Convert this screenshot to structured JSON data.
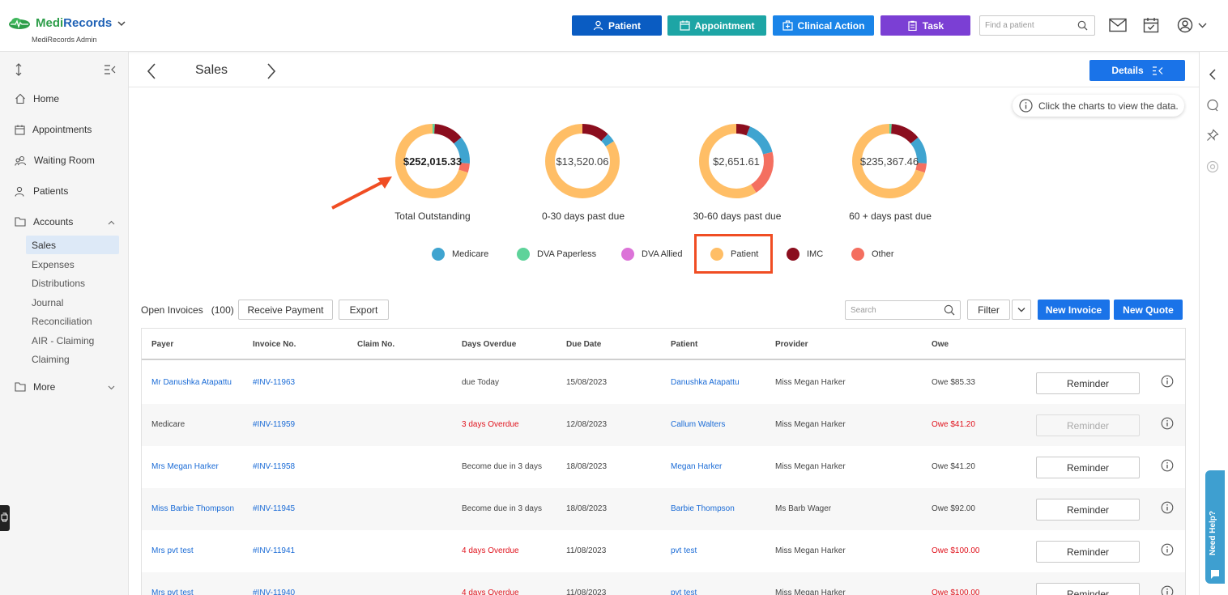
{
  "app": {
    "brand_part1": "Medi",
    "brand_part2": "Records",
    "subtitle": "MediRecords Admin"
  },
  "topbar": {
    "buttons": [
      {
        "label": "Patient",
        "color": "#0a5cc2"
      },
      {
        "label": "Appointment",
        "color": "#1da5a5"
      },
      {
        "label": "Clinical Action",
        "color": "#1a84e8"
      },
      {
        "label": "Task",
        "color": "#7b3fd4"
      }
    ],
    "search_placeholder": "Find a patient"
  },
  "sidebar": {
    "items": [
      {
        "label": "Home",
        "icon": "home-icon"
      },
      {
        "label": "Appointments",
        "icon": "calendar-icon"
      },
      {
        "label": "Waiting Room",
        "icon": "users-icon"
      },
      {
        "label": "Patients",
        "icon": "user-icon"
      },
      {
        "label": "Accounts",
        "icon": "folder-icon"
      }
    ],
    "accounts_sub": [
      "Sales",
      "Expenses",
      "Distributions",
      "Journal",
      "Reconciliation",
      "AIR - Claiming",
      "Claiming"
    ],
    "more_label": "More"
  },
  "page": {
    "title": "Sales",
    "details_label": "Details",
    "hint": "Click the charts to view the data."
  },
  "chart_data": {
    "type": "pie",
    "charts": [
      {
        "label": "Total Outstanding",
        "center": "$252,015.33",
        "slices": {
          "Medicare": 12,
          "DVA Paperless": 1,
          "DVA Allied": 0,
          "Patient": 70,
          "IMC": 13,
          "Other": 4
        }
      },
      {
        "label": "0-30 days past due",
        "center": "$13,520.06",
        "slices": {
          "Medicare": 4,
          "DVA Paperless": 0,
          "DVA Allied": 0,
          "Patient": 84,
          "IMC": 12,
          "Other": 0
        }
      },
      {
        "label": "30-60 days past due",
        "center": "$2,651.61",
        "slices": {
          "Medicare": 15,
          "DVA Paperless": 0,
          "DVA Allied": 0,
          "Patient": 59,
          "IMC": 6,
          "Other": 20
        }
      },
      {
        "label": "60 + days past due",
        "center": "$235,367.46",
        "slices": {
          "Medicare": 12,
          "DVA Paperless": 1,
          "DVA Allied": 0,
          "Patient": 70,
          "IMC": 13,
          "Other": 4
        }
      }
    ],
    "legend": [
      {
        "name": "Medicare",
        "color": "#3fa4d0"
      },
      {
        "name": "DVA Paperless",
        "color": "#5ed39a"
      },
      {
        "name": "DVA Allied",
        "color": "#dc73d8"
      },
      {
        "name": "Patient",
        "color": "#ffbe66"
      },
      {
        "name": "IMC",
        "color": "#8b0e1e"
      },
      {
        "name": "Other",
        "color": "#f46f60"
      }
    ]
  },
  "invoices": {
    "label": "Open Invoices",
    "count": "(100)",
    "receive_payment": "Receive Payment",
    "export": "Export",
    "search_placeholder": "Search",
    "filter": "Filter",
    "new_invoice": "New Invoice",
    "new_quote": "New Quote",
    "columns": [
      "Payer",
      "Invoice No.",
      "Claim No.",
      "Days Overdue",
      "Due Date",
      "Patient",
      "Provider",
      "Owe"
    ],
    "reminder_label": "Reminder",
    "rows": [
      {
        "payer": "Mr Danushka Atapattu",
        "payer_link": true,
        "invoice": "#INV-11963",
        "claim": "",
        "days": "due Today",
        "days_red": false,
        "due": "15/08/2023",
        "patient": "Danushka Atapattu",
        "provider": "Miss Megan Harker",
        "owe": "Owe $85.33",
        "owe_red": false,
        "disabled": false
      },
      {
        "payer": "Medicare",
        "payer_link": false,
        "invoice": "#INV-11959",
        "claim": "",
        "days": "3 days Overdue",
        "days_red": true,
        "due": "12/08/2023",
        "patient": "Callum Walters",
        "provider": "Miss Megan Harker",
        "owe": "Owe $41.20",
        "owe_red": true,
        "disabled": true
      },
      {
        "payer": "Mrs Megan Harker",
        "payer_link": true,
        "invoice": "#INV-11958",
        "claim": "",
        "days": "Become due in 3 days",
        "days_red": false,
        "due": "18/08/2023",
        "patient": "Megan Harker",
        "provider": "Miss Megan Harker",
        "owe": "Owe $41.20",
        "owe_red": false,
        "disabled": false
      },
      {
        "payer": "Miss Barbie Thompson",
        "payer_link": true,
        "invoice": "#INV-11945",
        "claim": "",
        "days": "Become due in 3 days",
        "days_red": false,
        "due": "18/08/2023",
        "patient": "Barbie Thompson",
        "provider": "Ms Barb Wager",
        "owe": "Owe $92.00",
        "owe_red": false,
        "disabled": false
      },
      {
        "payer": "Mrs pvt test",
        "payer_link": true,
        "invoice": "#INV-11941",
        "claim": "",
        "days": "4 days Overdue",
        "days_red": true,
        "due": "11/08/2023",
        "patient": "pvt test",
        "provider": "Miss Megan Harker",
        "owe": "Owe $100.00",
        "owe_red": true,
        "disabled": false
      },
      {
        "payer": "Mrs pvt test",
        "payer_link": true,
        "invoice": "#INV-11940",
        "claim": "",
        "days": "4 days Overdue",
        "days_red": true,
        "due": "11/08/2023",
        "patient": "pvt test",
        "provider": "Miss Megan Harker",
        "owe": "Owe $100.00",
        "owe_red": true,
        "disabled": false
      }
    ]
  },
  "help": {
    "label": "Need Help?"
  }
}
